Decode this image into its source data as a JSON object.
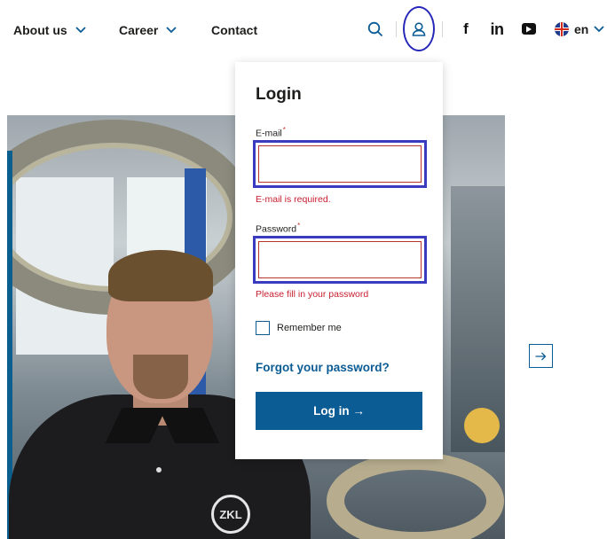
{
  "nav": {
    "items": [
      {
        "label": "About us"
      },
      {
        "label": "Career"
      },
      {
        "label": "Contact"
      }
    ],
    "language": "en",
    "social": {
      "facebook": "f",
      "linkedin": "in"
    }
  },
  "icons": {
    "search": "search-icon",
    "user": "user-icon",
    "facebook": "facebook-icon",
    "linkedin": "linkedin-icon",
    "youtube": "youtube-icon",
    "flag": "uk-flag-icon",
    "next": "arrow-right-icon"
  },
  "hero": {
    "logo_text": "ZKL"
  },
  "login": {
    "title": "Login",
    "email_label": "E-mail",
    "email_value": "",
    "email_error": "E-mail is required.",
    "password_label": "Password",
    "password_value": "",
    "password_error": "Please fill in your password",
    "required_mark": "*",
    "remember_label": "Remember me",
    "forgot_label": "Forgot your password?",
    "submit_label": "Log in →"
  },
  "colors": {
    "brand_blue": "#0b5c94",
    "error_red": "#c8202f",
    "highlight": "#3b3bbf"
  }
}
